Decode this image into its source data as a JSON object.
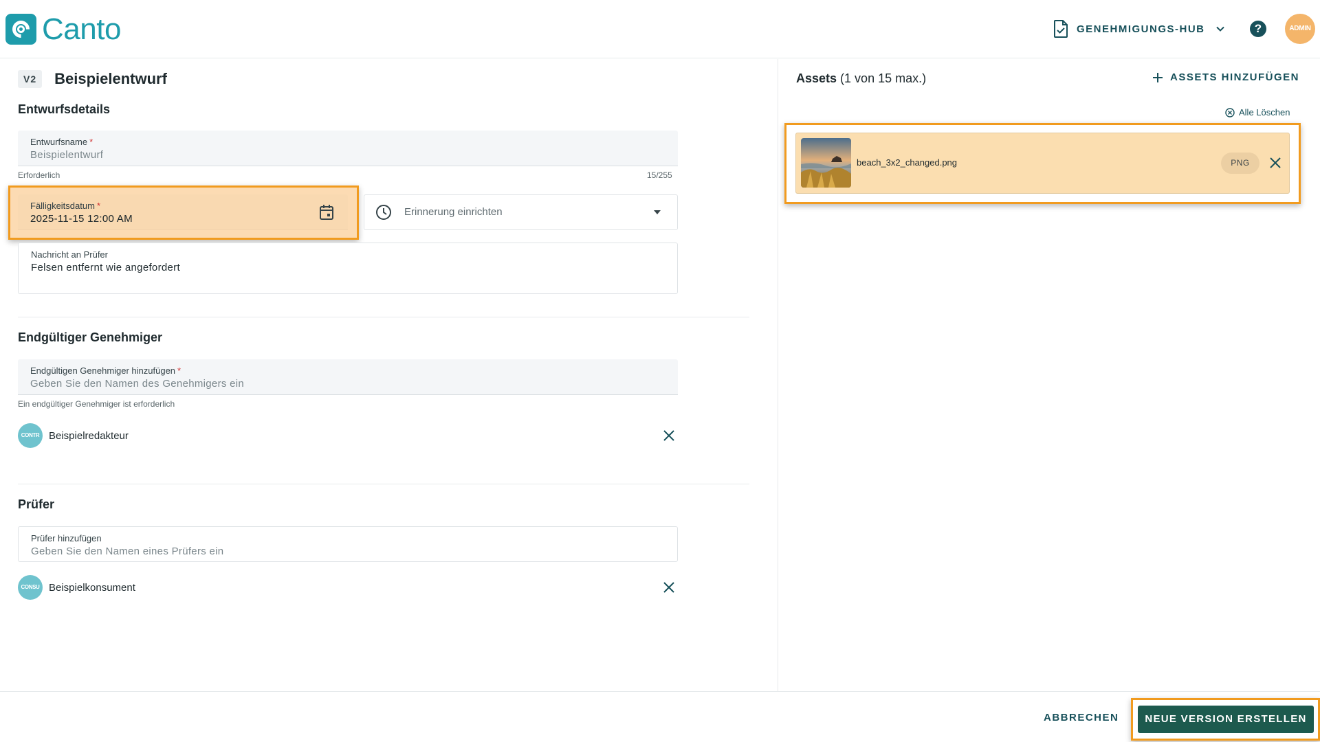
{
  "header": {
    "logo_text": "Canto",
    "hub_label": "GENEHMIGUNGS-HUB",
    "help_glyph": "?",
    "avatar_text": "ADMIN"
  },
  "draft": {
    "version_badge": "V2",
    "title": "Beispielentwurf",
    "section_details": "Entwurfsdetails",
    "name_label": "Entwurfsname",
    "name_value": "Beispielentwurf",
    "name_helper": "Erforderlich",
    "name_counter": "15/255",
    "due_label": "Fälligkeitsdatum",
    "due_value": "2025-11-15 12:00 AM",
    "reminder_placeholder": "Erinnerung einrichten",
    "message_label": "Nachricht an Prüfer",
    "message_value": "Felsen entfernt wie angefordert"
  },
  "final_approver": {
    "section": "Endgültiger Genehmiger",
    "input_label": "Endgültigen Genehmiger hinzufügen",
    "input_placeholder": "Geben Sie den Namen des Genehmigers ein",
    "helper": "Ein endgültiger Genehmiger ist erforderlich",
    "person_avatar": "CONTR",
    "person_name": "Beispielredakteur"
  },
  "reviewers": {
    "section": "Prüfer",
    "input_label": "Prüfer hinzufügen",
    "input_placeholder": "Geben Sie den Namen eines Prüfers ein",
    "person_avatar": "CONSU",
    "person_name": "Beispielkonsument"
  },
  "assets": {
    "title_bold": "Assets",
    "title_rest": " (1 von 15 max.)",
    "add_label": "ASSETS HINZUFÜGEN",
    "clear_label": "Alle Löschen",
    "items": [
      {
        "name": "beach_3x2_changed.png",
        "type": "PNG"
      }
    ]
  },
  "footer": {
    "cancel_label": "ABBRECHEN",
    "create_label": "NEUE VERSION ERSTELLEN"
  },
  "colors": {
    "brand": "#1e9cab",
    "primary_dark": "#17505a",
    "create_button": "#1d5a4e",
    "highlight": "#f19b1f",
    "asset_card": "#fbdeb0",
    "required": "#d23b3b"
  }
}
